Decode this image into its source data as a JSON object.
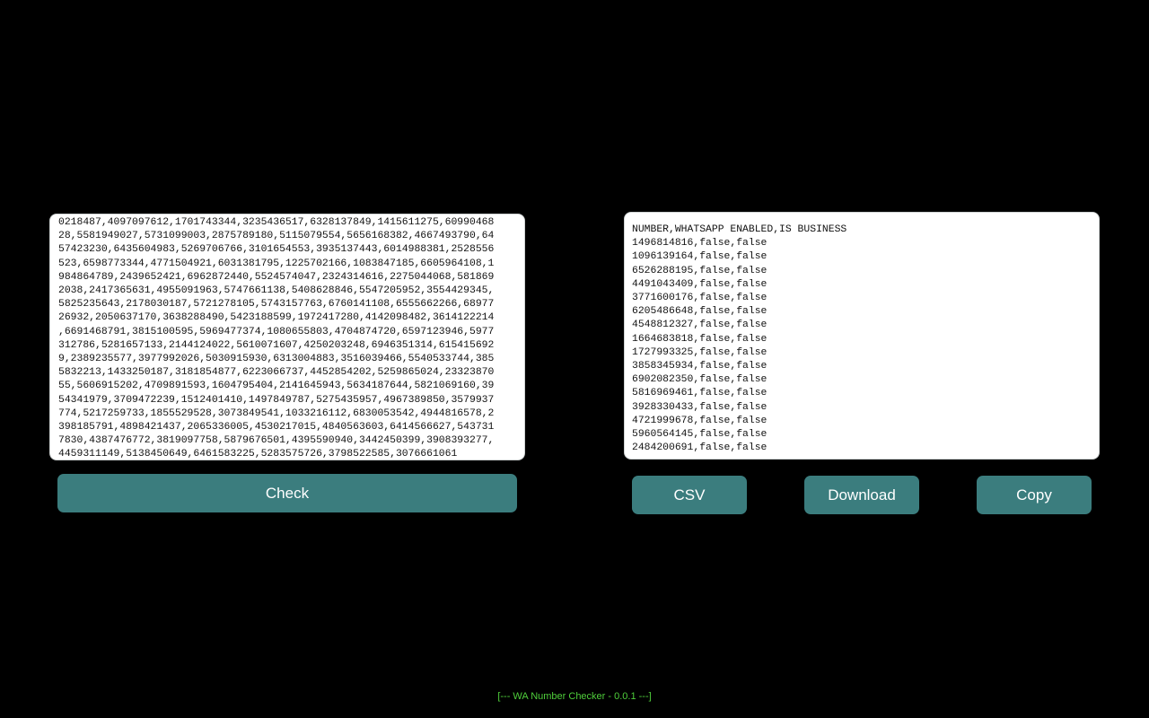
{
  "input": {
    "lines": [
      "0218487,4097097612,1701743344,3235436517,6328137849,1415611275,60990468",
      "28,5581949027,5731099003,2875789180,5115079554,5656168382,4667493790,64",
      "57423230,6435604983,5269706766,3101654553,3935137443,6014988381,2528556",
      "523,6598773344,4771504921,6031381795,1225702166,1083847185,6605964108,1",
      "984864789,2439652421,6962872440,5524574047,2324314616,2275044068,581869",
      "2038,2417365631,4955091963,5747661138,5408628846,5547205952,3554429345,",
      "5825235643,2178030187,5721278105,5743157763,6760141108,6555662266,68977",
      "26932,2050637170,3638288490,5423188599,1972417280,4142098482,3614122214",
      ",6691468791,3815100595,5969477374,1080655803,4704874720,6597123946,5977",
      "312786,5281657133,2144124022,5610071607,4250203248,6946351314,615415692",
      "9,2389235577,3977992026,5030915930,6313004883,3516039466,5540533744,385",
      "5832213,1433250187,3181854877,6223066737,4452854202,5259865024,23323870",
      "55,5606915202,4709891593,1604795404,2141645943,5634187644,5821069160,39",
      "54341979,3709472239,1512401410,1497849787,5275435957,4967389850,3579937",
      "774,5217259733,1855529528,3073849541,1033216112,6830053542,4944816578,2",
      "398185791,4898421437,2065336005,4530217015,4840563603,6414566627,543731",
      "7830,4387476772,3819097758,5879676501,4395590940,3442450399,3908393277,",
      "4459311149,5138450649,6461583225,5283575726,3798522585,3076661061"
    ]
  },
  "output": {
    "lines": [
      "NUMBER,WHATSAPP ENABLED,IS BUSINESS",
      "1496814816,false,false",
      "1096139164,false,false",
      "6526288195,false,false",
      "4491043409,false,false",
      "3771600176,false,false",
      "6205486648,false,false",
      "4548812327,false,false",
      "1664683818,false,false",
      "1727993325,false,false",
      "3858345934,false,false",
      "6902082350,false,false",
      "5816969461,false,false",
      "3928330433,false,false",
      "4721999678,false,false",
      "5960564145,false,false",
      "2484200691,false,false"
    ]
  },
  "buttons": {
    "check": "Check",
    "csv": "CSV",
    "download": "Download",
    "copy": "Copy"
  },
  "footer": {
    "text": "[--- WA Number Checker - 0.0.1 ---]"
  },
  "colors": {
    "background": "#000000",
    "button": "#3b7d7e",
    "footer_text": "#4fce3b"
  }
}
